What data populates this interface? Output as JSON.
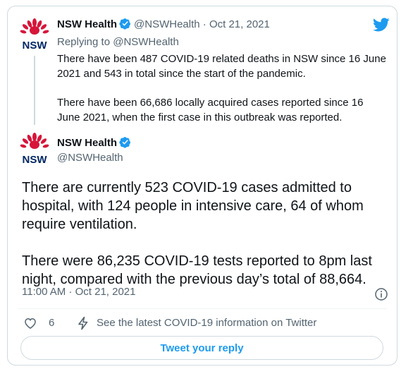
{
  "quoted_tweet": {
    "name": "NSW Health",
    "handle": "@NSWHealth",
    "separator": "·",
    "date": "Oct 21, 2021",
    "reply_to": "Replying to @NSWHealth",
    "paragraphs": [
      "There have been 487 COVID-19 related deaths in NSW since 16 June 2021 and 543 in total since the start of the pandemic.",
      "There have been 66,686 locally acquired cases reported since 16 June 2021, when the first case in this outbreak was reported."
    ]
  },
  "main_tweet": {
    "name": "NSW Health",
    "handle": "@NSWHealth",
    "paragraphs": [
      "There are currently 523 COVID-19 cases admitted to hospital, with 124 people in intensive care, 64 of whom require ventilation.",
      "There were 86,235 COVID-19 tests reported to 8pm last night, compared with the previous day’s total of 88,664."
    ],
    "timestamp": "11:00 AM · Oct 21, 2021"
  },
  "actions": {
    "like_count": "6",
    "info_link": "See the latest COVID-19 information on Twitter"
  },
  "reply_button": "Tweet your reply",
  "logo": {
    "brand_text": "NSW"
  },
  "icons": {
    "twitter": "twitter-bird-icon",
    "verified": "verified-badge-icon",
    "info": "info-icon",
    "like": "heart-icon",
    "bolt": "lightning-icon"
  },
  "colors": {
    "accent": "#1d9bf0",
    "waratah_red": "#d7153a",
    "nsw_navy": "#002664",
    "muted_text": "#536471",
    "border": "#cfd9de"
  }
}
